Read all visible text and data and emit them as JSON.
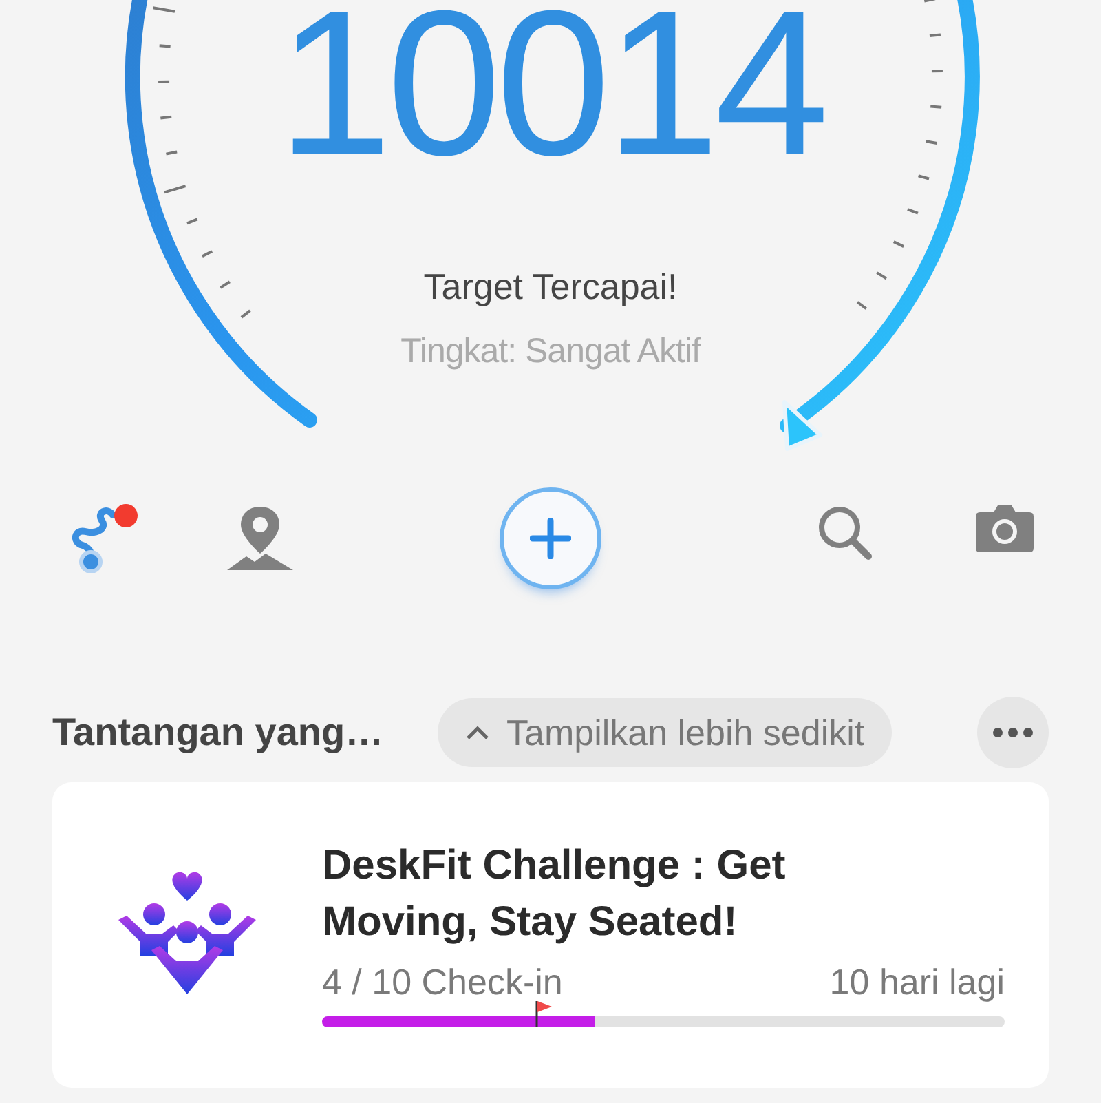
{
  "gauge": {
    "steps": "10014",
    "status": "Target Tercapai!",
    "activity": "Tingkat: Sangat Aktif"
  },
  "actions": [
    {
      "kind": "route",
      "badge": true
    },
    {
      "kind": "pin",
      "badge": false
    },
    {
      "kind": "add",
      "badge": false
    },
    {
      "kind": "search",
      "badge": false
    },
    {
      "kind": "camera",
      "badge": false
    }
  ],
  "section": {
    "title": "Tantangan yang…",
    "toggle_label": "Tampilkan lebih sedikit"
  },
  "challenge": {
    "title": "DeskFit Challenge : Get Moving, Stay Seated!",
    "progress_text": "4 / 10 Check-in",
    "remaining": "10 hari lagi",
    "level": 0.4
  }
}
